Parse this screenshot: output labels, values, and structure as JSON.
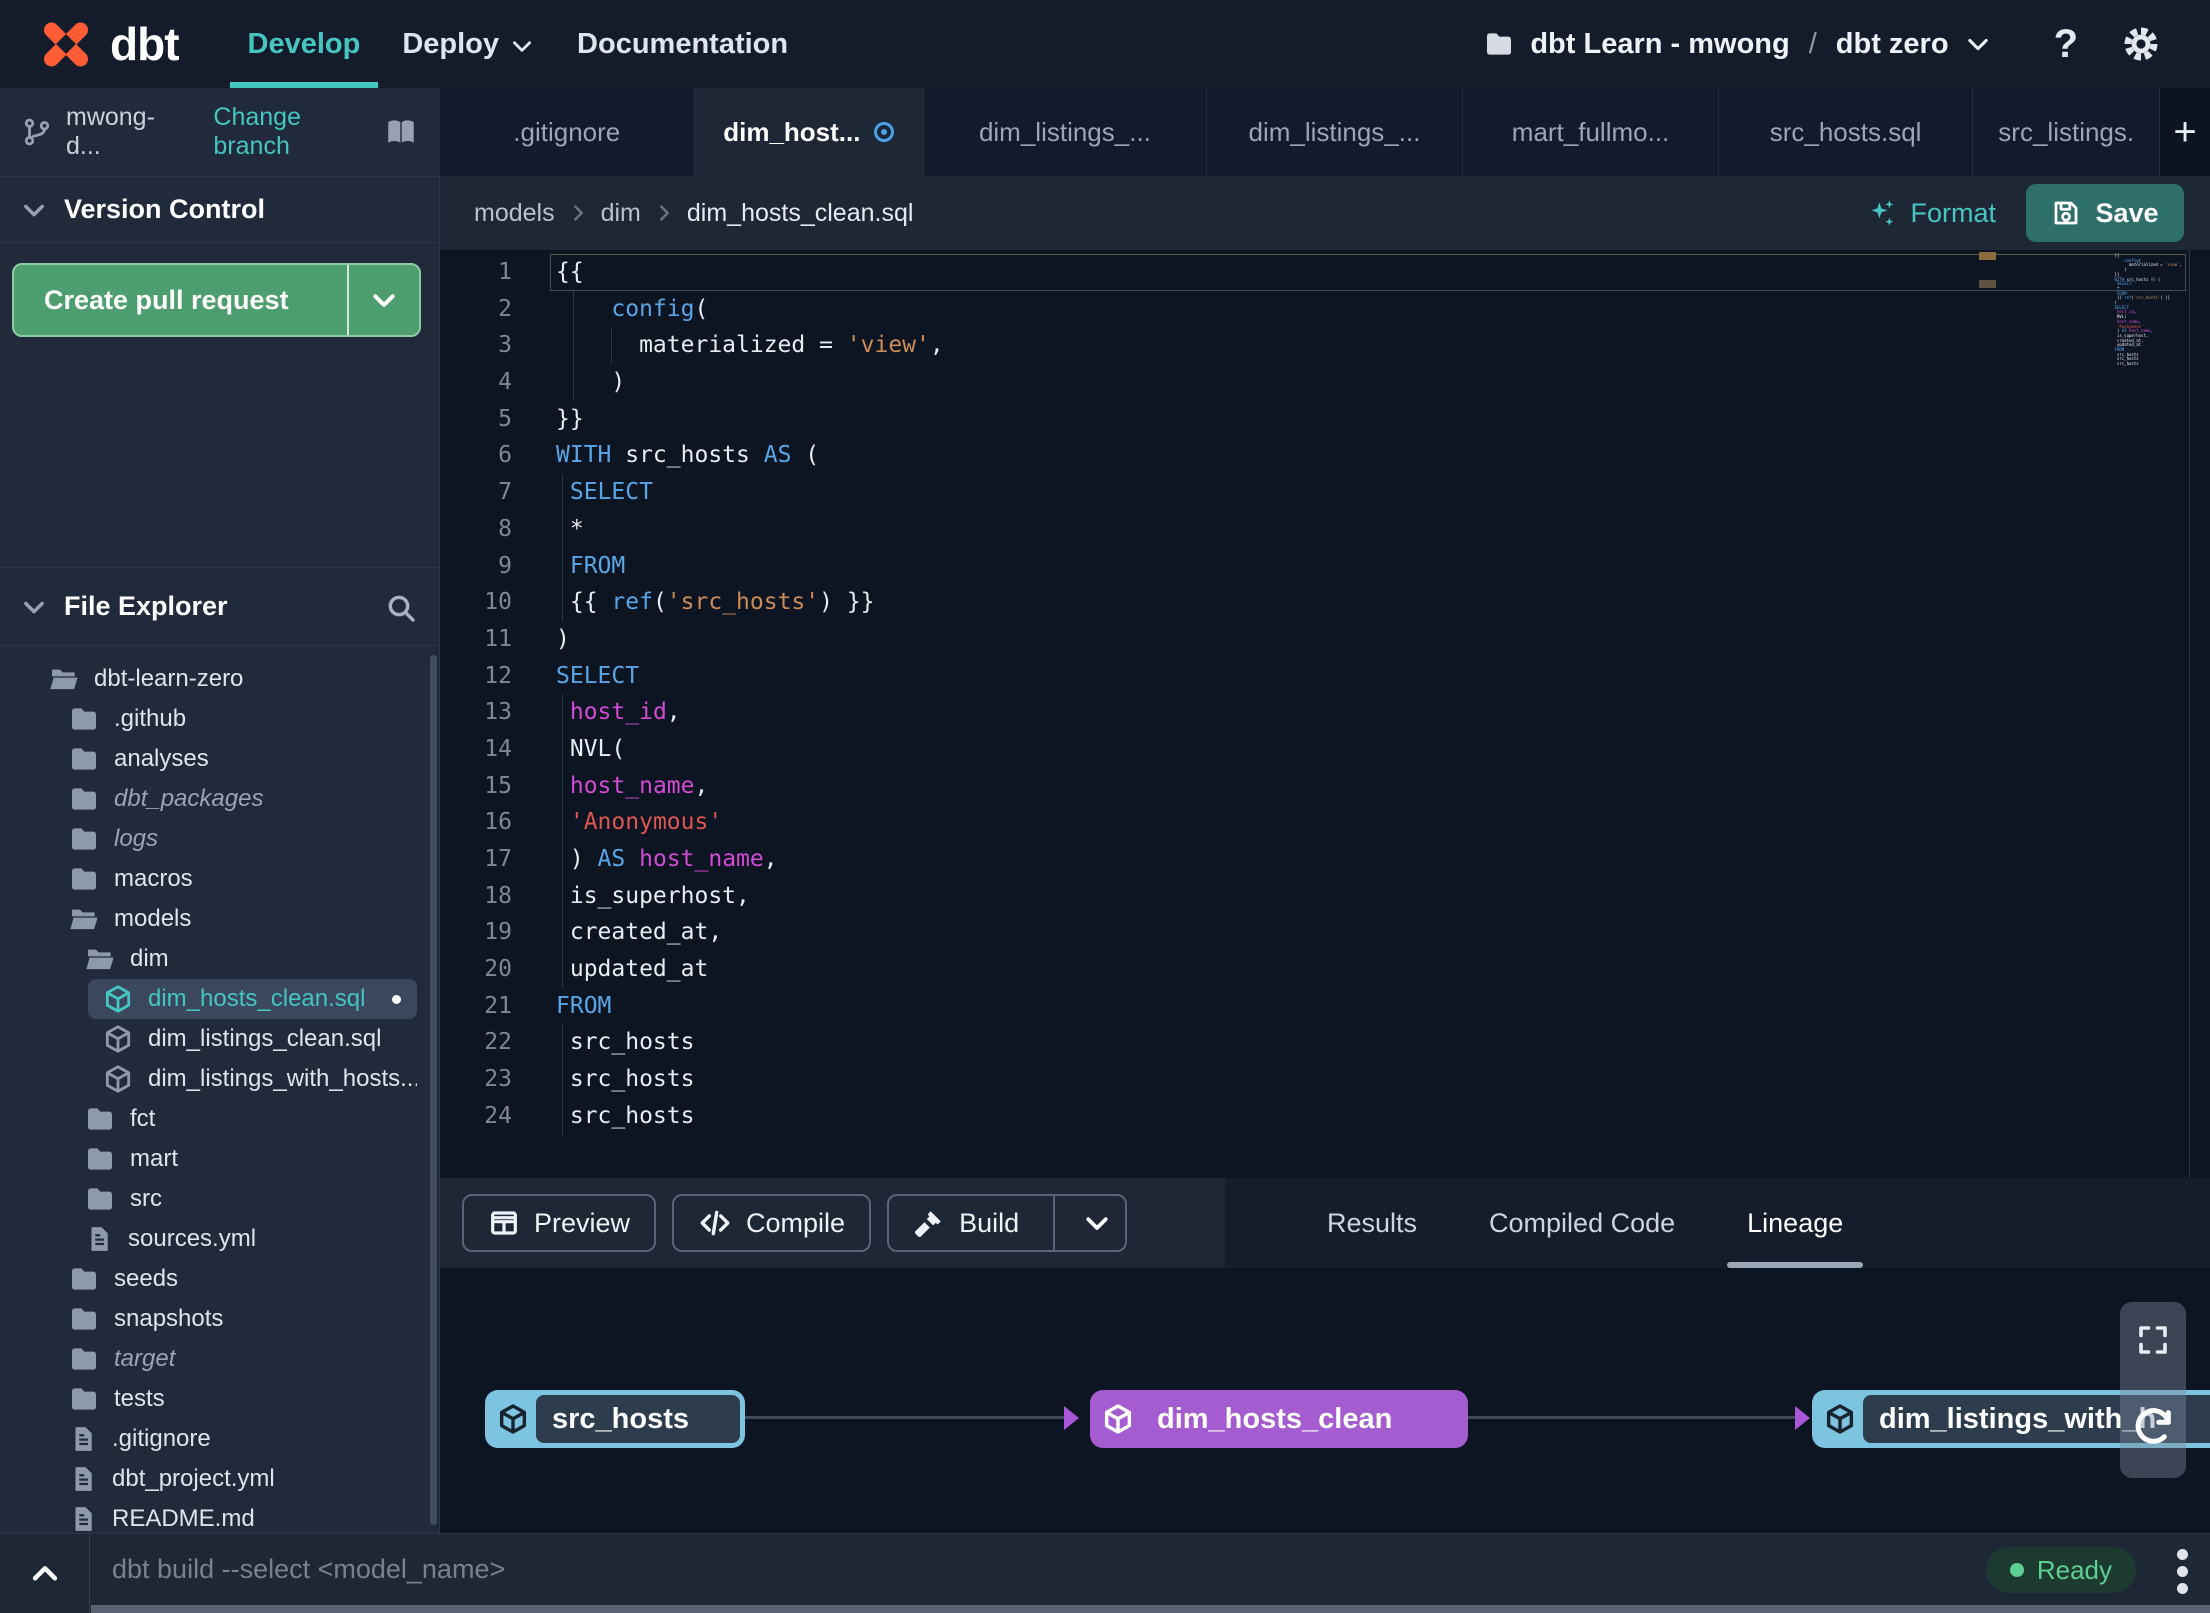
{
  "colors": {
    "accent_teal": "#45c6c1",
    "brand_orange": "#ff5c35",
    "save_button": "#2e6f6c",
    "pr_button_green": "#4d9e6e",
    "node_source_blue": "#7dc4e0",
    "node_selected_purple": "#a55cd0",
    "ready_green": "#5ecf92",
    "modified_blue": "#4aa3e8"
  },
  "topbar": {
    "brand": "dbt",
    "nav": {
      "develop": "Develop",
      "deploy": "Deploy",
      "documentation": "Documentation"
    },
    "project": {
      "account": "dbt Learn - mwong",
      "separator": "/",
      "name": "dbt zero"
    },
    "help_glyph": "?"
  },
  "branch_bar": {
    "branch_name": "mwong-d...",
    "change_branch_label": "Change branch"
  },
  "sidebar": {
    "version_control": {
      "title": "Version Control",
      "create_pr_label": "Create pull request"
    },
    "file_explorer": {
      "title": "File Explorer"
    },
    "tree": [
      {
        "label": "dbt-learn-zero",
        "icon": "folder-open",
        "level": 0
      },
      {
        "label": ".github",
        "icon": "folder",
        "level": 1
      },
      {
        "label": "analyses",
        "icon": "folder",
        "level": 1
      },
      {
        "label": "dbt_packages",
        "icon": "folder",
        "level": 1,
        "italic": true
      },
      {
        "label": "logs",
        "icon": "folder",
        "level": 1,
        "italic": true
      },
      {
        "label": "macros",
        "icon": "folder",
        "level": 1
      },
      {
        "label": "models",
        "icon": "folder-open",
        "level": 1
      },
      {
        "label": "dim",
        "icon": "folder-open",
        "level": 2
      },
      {
        "label": "dim_hosts_clean.sql",
        "icon": "model",
        "level": 3,
        "selected": true,
        "modified": true
      },
      {
        "label": "dim_listings_clean.sql",
        "icon": "model",
        "level": 3
      },
      {
        "label": "dim_listings_with_hosts...",
        "icon": "model",
        "level": 3
      },
      {
        "label": "fct",
        "icon": "folder",
        "level": 2
      },
      {
        "label": "mart",
        "icon": "folder",
        "level": 2
      },
      {
        "label": "src",
        "icon": "folder",
        "level": 2
      },
      {
        "label": "sources.yml",
        "icon": "file",
        "level": 2
      },
      {
        "label": "seeds",
        "icon": "folder",
        "level": 1
      },
      {
        "label": "snapshots",
        "icon": "folder",
        "level": 1
      },
      {
        "label": "target",
        "icon": "folder",
        "level": 1,
        "italic": true
      },
      {
        "label": "tests",
        "icon": "folder",
        "level": 1
      },
      {
        "label": ".gitignore",
        "icon": "file",
        "level": 1
      },
      {
        "label": "dbt_project.yml",
        "icon": "file",
        "level": 1
      },
      {
        "label": "README.md",
        "icon": "file",
        "level": 1
      }
    ]
  },
  "tabs": {
    "new_tab_label": "+",
    "items": [
      {
        "label": ".gitignore"
      },
      {
        "label": "dim_host...",
        "active": true,
        "modified": true
      },
      {
        "label": "dim_listings_..."
      },
      {
        "label": "dim_listings_..."
      },
      {
        "label": "mart_fullmo..."
      },
      {
        "label": "src_hosts.sql"
      },
      {
        "label": "src_listings."
      }
    ]
  },
  "editor": {
    "breadcrumb": [
      "models",
      "dim",
      "dim_hosts_clean.sql"
    ],
    "format_label": "Format",
    "save_label": "Save",
    "code": [
      {
        "n": 1,
        "cur": true,
        "tokens": [
          [
            "p",
            "{{"
          ]
        ]
      },
      {
        "n": 2,
        "g": [
          1.2
        ],
        "tokens": [
          [
            "p",
            "    "
          ],
          [
            "k",
            "config"
          ],
          [
            "p",
            "("
          ]
        ]
      },
      {
        "n": 3,
        "g": [
          1.2,
          4
        ],
        "tokens": [
          [
            "p",
            "      materialized = "
          ],
          [
            "s",
            "'view'"
          ],
          [
            "p",
            ","
          ]
        ]
      },
      {
        "n": 4,
        "g": [
          1.2
        ],
        "tokens": [
          [
            "p",
            "    )"
          ]
        ]
      },
      {
        "n": 5,
        "tokens": [
          [
            "p",
            "}}"
          ]
        ]
      },
      {
        "n": 6,
        "tokens": [
          [
            "k",
            "WITH"
          ],
          [
            "p",
            " src_hosts "
          ],
          [
            "k",
            "AS"
          ],
          [
            "p",
            " ("
          ]
        ]
      },
      {
        "n": 7,
        "g": [
          0.45
        ],
        "tokens": [
          [
            "p",
            " "
          ],
          [
            "k",
            "SELECT"
          ]
        ]
      },
      {
        "n": 8,
        "g": [
          0.45
        ],
        "tokens": [
          [
            "p",
            " *"
          ]
        ]
      },
      {
        "n": 9,
        "g": [
          0.45
        ],
        "tokens": [
          [
            "p",
            " "
          ],
          [
            "k",
            "FROM"
          ]
        ]
      },
      {
        "n": 10,
        "g": [
          0.45
        ],
        "tokens": [
          [
            "p",
            " {{ "
          ],
          [
            "k",
            "ref"
          ],
          [
            "p",
            "("
          ],
          [
            "s",
            "'src_hosts'"
          ],
          [
            "p",
            ") }}"
          ]
        ]
      },
      {
        "n": 11,
        "tokens": [
          [
            "p",
            ")"
          ]
        ]
      },
      {
        "n": 12,
        "tokens": [
          [
            "k",
            "SELECT"
          ]
        ]
      },
      {
        "n": 13,
        "g": [
          0.45
        ],
        "tokens": [
          [
            "p",
            " "
          ],
          [
            "i",
            "host_id"
          ],
          [
            "p",
            ","
          ]
        ]
      },
      {
        "n": 14,
        "g": [
          0.45
        ],
        "tokens": [
          [
            "p",
            " NVL("
          ]
        ]
      },
      {
        "n": 15,
        "g": [
          0.45
        ],
        "tokens": [
          [
            "p",
            " "
          ],
          [
            "i",
            "host_name"
          ],
          [
            "p",
            ","
          ]
        ]
      },
      {
        "n": 16,
        "g": [
          0.45
        ],
        "tokens": [
          [
            "p",
            " "
          ],
          [
            "r",
            "'Anonymous'"
          ]
        ]
      },
      {
        "n": 17,
        "g": [
          0.45
        ],
        "tokens": [
          [
            "p",
            " ) "
          ],
          [
            "k",
            "AS"
          ],
          [
            "p",
            " "
          ],
          [
            "i",
            "host_name"
          ],
          [
            "p",
            ","
          ]
        ]
      },
      {
        "n": 18,
        "g": [
          0.45
        ],
        "tokens": [
          [
            "p",
            " is_superhost,"
          ]
        ]
      },
      {
        "n": 19,
        "g": [
          0.45
        ],
        "tokens": [
          [
            "p",
            " created_at,"
          ]
        ]
      },
      {
        "n": 20,
        "g": [
          0.45
        ],
        "tokens": [
          [
            "p",
            " updated_at"
          ]
        ]
      },
      {
        "n": 21,
        "tokens": [
          [
            "k",
            "FROM"
          ]
        ]
      },
      {
        "n": 22,
        "g": [
          0.45
        ],
        "tokens": [
          [
            "p",
            " src_hosts"
          ]
        ]
      },
      {
        "n": 23,
        "g": [
          0.45
        ],
        "tokens": [
          [
            "p",
            " src_hosts"
          ]
        ]
      },
      {
        "n": 24,
        "g": [
          0.45
        ],
        "tokens": [
          [
            "p",
            " src_hosts"
          ]
        ]
      }
    ]
  },
  "bottom_panel": {
    "buttons": {
      "preview": "Preview",
      "compile": "Compile",
      "build": "Build"
    },
    "tabs": {
      "results": "Results",
      "compiled_code": "Compiled Code",
      "lineage": "Lineage"
    },
    "lineage_nodes": [
      {
        "label": "src_hosts",
        "variant": "source"
      },
      {
        "label": "dim_hosts_clean",
        "variant": "selected"
      },
      {
        "label": "dim_listings_with_h",
        "variant": "source"
      }
    ]
  },
  "statusbar": {
    "command_placeholder": "dbt build --select <model_name>",
    "status_label": "Ready"
  }
}
